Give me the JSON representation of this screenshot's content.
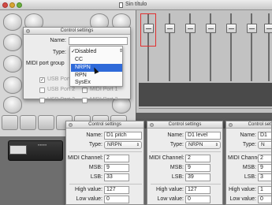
{
  "window": {
    "title": "Sin título"
  },
  "settings_dialog": {
    "title": "Control settings",
    "name_label": "Name:",
    "name_value": "",
    "type_label": "Type:",
    "midi_port_group_label": "MIDI port group",
    "type_options": [
      "Disabled",
      "CC",
      "NRPN",
      "RPN",
      "SysEx"
    ],
    "type_checked": "Disabled",
    "type_highlighted": "NRPN",
    "ports": [
      "USB Port 1",
      "USB Port 2",
      "USB Port 3",
      "MIDI Port 1",
      "MIDI Port 2"
    ]
  },
  "control_dialogs": [
    {
      "title": "Control settings",
      "name_label": "Name:",
      "name": "D1 pitch",
      "type_label": "Type:",
      "type": "NRPN",
      "channel_label": "MIDI Channel:",
      "channel": "2",
      "msb_label": "MSB:",
      "msb": "9",
      "lsb_label": "LSB:",
      "lsb": "33",
      "high_label": "High value:",
      "high": "127",
      "low_label": "Low value:",
      "low": "0"
    },
    {
      "title": "Control settings",
      "name_label": "Name:",
      "name": "D1 level",
      "type_label": "Type:",
      "type": "NRPN",
      "channel_label": "MIDI Channel:",
      "channel": "2",
      "msb_label": "MSB:",
      "msb": "9",
      "lsb_label": "LSB:",
      "lsb": "39",
      "high_label": "High value:",
      "high": "127",
      "low_label": "Low value:",
      "low": "0"
    },
    {
      "title": "Control settings",
      "name_label": "Name:",
      "name": "D1",
      "type_label": "Type:",
      "type": "N",
      "channel_label": "MIDI Channel:",
      "channel": "2",
      "msb_label": "MSB:",
      "msb": "9",
      "lsb_label": "LSB:",
      "lsb": "3",
      "high_label": "High value:",
      "high": "1",
      "low_label": "Low value:",
      "low": "0"
    }
  ],
  "icons": {
    "close": "close-icon",
    "doc": "document-icon",
    "arrow": "dropdown-arrow-icon",
    "cursor": "mouse-pointer-icon"
  },
  "colors": {
    "highlight": "#2f6ad9",
    "selected_fader_frame": "#e03030"
  }
}
